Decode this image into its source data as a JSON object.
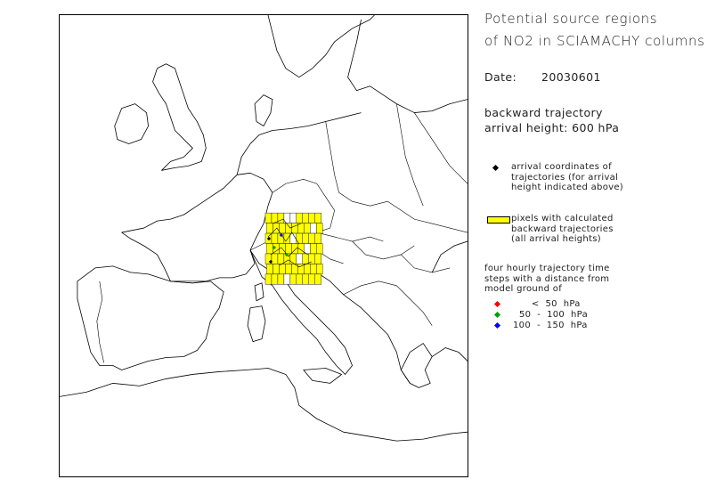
{
  "title": {
    "line1": "Potential source regions",
    "line2": "of NO2 in SCIAMACHY columns"
  },
  "date": {
    "label": "Date:",
    "value": "20030601"
  },
  "trajectory": {
    "line1": "backward trajectory",
    "line2": "arrival height:  600  hPa"
  },
  "legend": {
    "arrival_text": "arrival coordinates of\ntrajectories (for arrival\nheight indicated above)",
    "pixels_text": "pixels with calculated\nbackward trajectories\n(all arrival heights)",
    "steps_text": "four hourly trajectory time\nsteps with a distance from\nmodel ground of",
    "ranges": [
      {
        "label": "      <  50  hPa",
        "color": "#ff0000"
      },
      {
        "label": "  50  -  100  hPa",
        "color": "#00a000"
      },
      {
        "label": "100  -  150  hPa",
        "color": "#0000ff"
      }
    ],
    "arrival_marker_color": "#000000",
    "pixel_fill_color": "#ffff00"
  },
  "map": {
    "highlight_region": "northern Italy / Alps",
    "grid_cols": 9,
    "grid_rows": 7
  }
}
